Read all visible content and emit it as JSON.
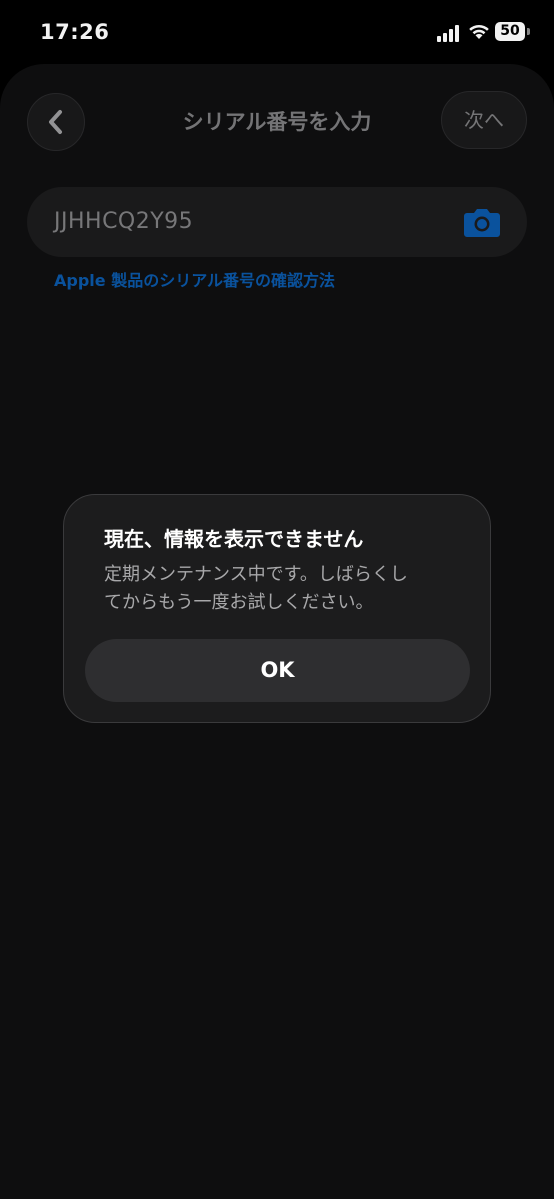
{
  "status_bar": {
    "time": "17:26",
    "battery": "50"
  },
  "nav": {
    "title": "シリアル番号を入力",
    "next_label": "次へ"
  },
  "serial_input": {
    "value": "JJHHCQ2Y95"
  },
  "help_link": "Apple 製品のシリアル番号の確認方法",
  "alert": {
    "title": "現在、情報を表示できません",
    "message": "定期メンテナンス中です。しばらくしてからもう一度お試しください。",
    "ok_label": "OK"
  },
  "colors": {
    "accent": "#0b57a6",
    "sheet_background": "#0f0f10",
    "alert_background": "#1c1c1d"
  },
  "icons": [
    "back-chevron-icon",
    "camera-icon",
    "signal-icon",
    "wifi-icon",
    "battery-icon"
  ]
}
